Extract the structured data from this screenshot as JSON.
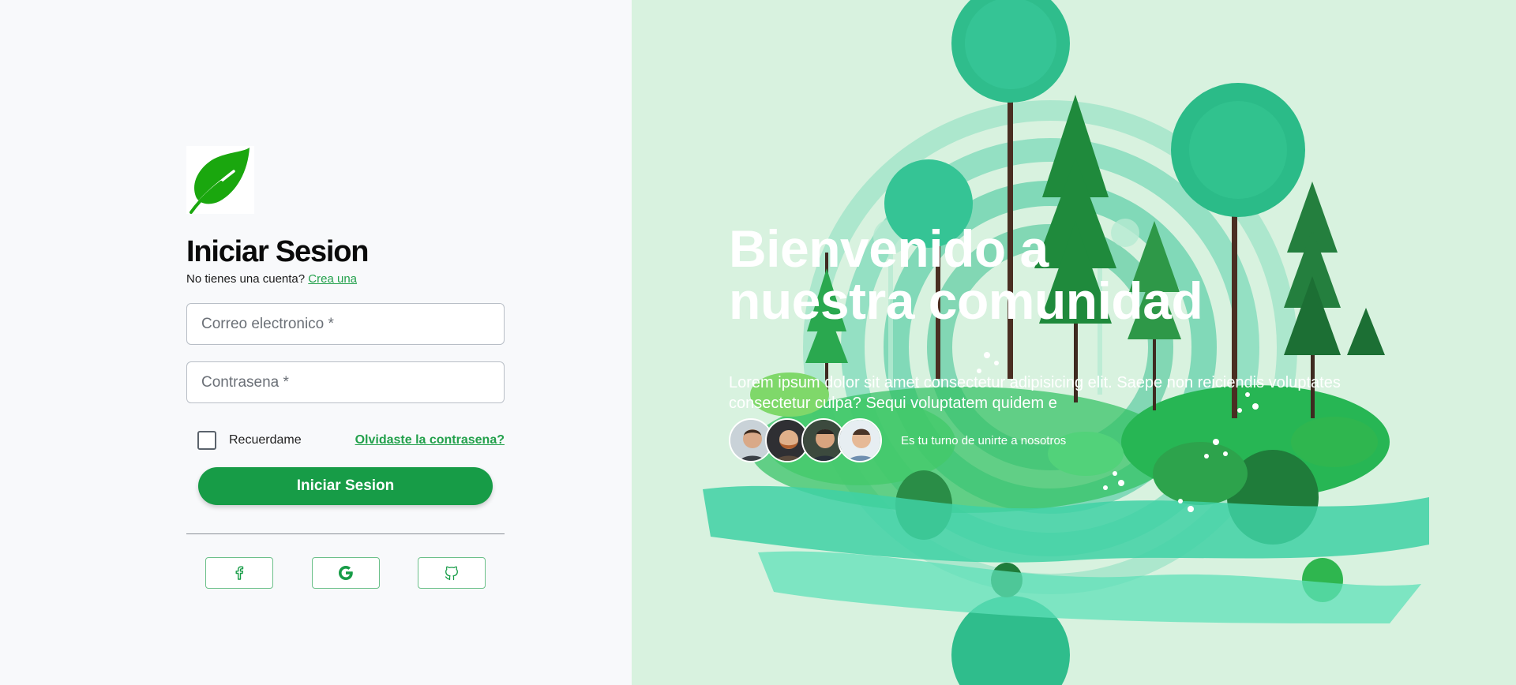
{
  "login": {
    "title": "Iniciar Sesion",
    "signup_prompt": "No tienes una cuenta?",
    "signup_link": "Crea una",
    "email_placeholder": "Correo electronico *",
    "password_placeholder": "Contrasena *",
    "remember_label": "Recuerdame",
    "forgot_link": "Olvidaste la contrasena?",
    "submit_label": "Iniciar Sesion",
    "social_buttons": [
      "facebook-icon",
      "google-icon",
      "github-icon"
    ]
  },
  "hero": {
    "title_line1": "Bienvenido a",
    "title_line2": "nuestra comunidad",
    "text": "Lorem ipsum dolor sit amet consectetur adipisicing elit. Saepe non reiciendis voluptates consectetur culpa? Sequi voluptatem quidem e",
    "join_text": "Es tu turno de unirte a nosotros"
  },
  "colors": {
    "accent": "#179c47",
    "link": "#22a04b",
    "hero_bg": "#d8f2df",
    "page_bg": "#f8f9fb"
  }
}
